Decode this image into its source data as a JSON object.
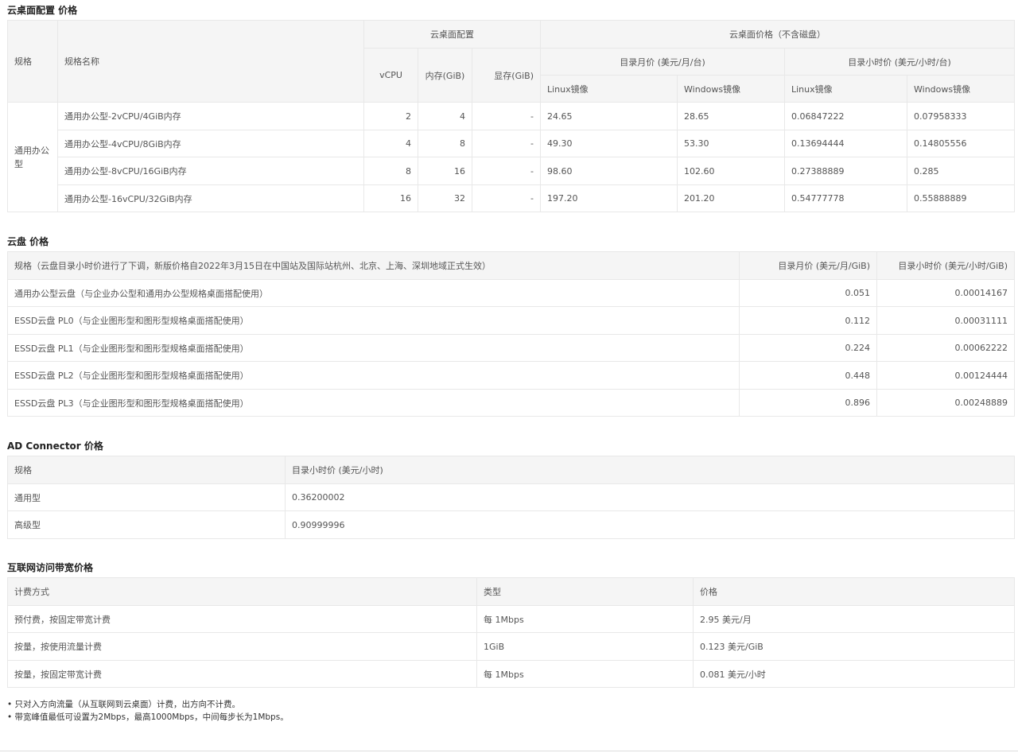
{
  "desktop": {
    "title": "云桌面配置 价格",
    "h_spec": "规格",
    "h_spec_name": "规格名称",
    "h_config": "云桌面配置",
    "h_price": "云桌面价格（不含磁盘）",
    "h_vcpu": "vCPU",
    "h_mem": "内存(GiB)",
    "h_gpu": "显存(GiB)",
    "h_monthly": "目录月价 (美元/月/台)",
    "h_hourly": "目录小时价 (美元/小时/台)",
    "h_linux": "Linux镜像",
    "h_windows": "Windows镜像",
    "spec_group": "通用办公型",
    "rows": [
      {
        "name": "通用办公型-2vCPU/4GiB内存",
        "vcpu": "2",
        "mem": "4",
        "gpu": "-",
        "m_linux": "24.65",
        "m_win": "28.65",
        "h_linux": "0.06847222",
        "h_win": "0.07958333"
      },
      {
        "name": "通用办公型-4vCPU/8GiB内存",
        "vcpu": "4",
        "mem": "8",
        "gpu": "-",
        "m_linux": "49.30",
        "m_win": "53.30",
        "h_linux": "0.13694444",
        "h_win": "0.14805556"
      },
      {
        "name": "通用办公型-8vCPU/16GiB内存",
        "vcpu": "8",
        "mem": "16",
        "gpu": "-",
        "m_linux": "98.60",
        "m_win": "102.60",
        "h_linux": "0.27388889",
        "h_win": "0.285"
      },
      {
        "name": "通用办公型-16vCPU/32GiB内存",
        "vcpu": "16",
        "mem": "32",
        "gpu": "-",
        "m_linux": "197.20",
        "m_win": "201.20",
        "h_linux": "0.54777778",
        "h_win": "0.55888889"
      }
    ]
  },
  "disk": {
    "title": "云盘 价格",
    "h_spec": "规格（云盘目录小时价进行了下调，新版价格自2022年3月15日在中国站及国际站杭州、北京、上海、深圳地域正式生效）",
    "h_monthly": "目录月价 (美元/月/GiB)",
    "h_hourly": "目录小时价 (美元/小时/GiB)",
    "rows": [
      {
        "spec": "通用办公型云盘（与企业办公型和通用办公型规格桌面搭配使用）",
        "monthly": "0.051",
        "hourly": "0.00014167"
      },
      {
        "spec": "ESSD云盘 PL0（与企业图形型和图形型规格桌面搭配使用）",
        "monthly": "0.112",
        "hourly": "0.00031111"
      },
      {
        "spec": "ESSD云盘 PL1（与企业图形型和图形型规格桌面搭配使用）",
        "monthly": "0.224",
        "hourly": "0.00062222"
      },
      {
        "spec": "ESSD云盘 PL2（与企业图形型和图形型规格桌面搭配使用）",
        "monthly": "0.448",
        "hourly": "0.00124444"
      },
      {
        "spec": "ESSD云盘 PL3（与企业图形型和图形型规格桌面搭配使用）",
        "monthly": "0.896",
        "hourly": "0.00248889"
      }
    ]
  },
  "ad": {
    "title": "AD Connector 价格",
    "h_spec": "规格",
    "h_hourly": "目录小时价 (美元/小时)",
    "rows": [
      {
        "spec": "通用型",
        "hourly": "0.36200002"
      },
      {
        "spec": "高级型",
        "hourly": "0.90999996"
      }
    ]
  },
  "bandwidth": {
    "title": "互联网访问带宽价格",
    "h_method": "计费方式",
    "h_type": "类型",
    "h_price": "价格",
    "rows": [
      {
        "method": "预付费，按固定带宽计费",
        "type": "每 1Mbps",
        "price": "2.95 美元/月"
      },
      {
        "method": "按量，按使用流量计费",
        "type": "1GiB",
        "price": "0.123 美元/GiB"
      },
      {
        "method": "按量，按固定带宽计费",
        "type": "每 1Mbps",
        "price": "0.081 美元/小时"
      }
    ]
  },
  "notes": [
    "• 只对入方向流量（从互联网到云桌面）计费，出方向不计费。",
    "• 带宽峰值最低可设置为2Mbps，最高1000Mbps，中间每步长为1Mbps。"
  ]
}
